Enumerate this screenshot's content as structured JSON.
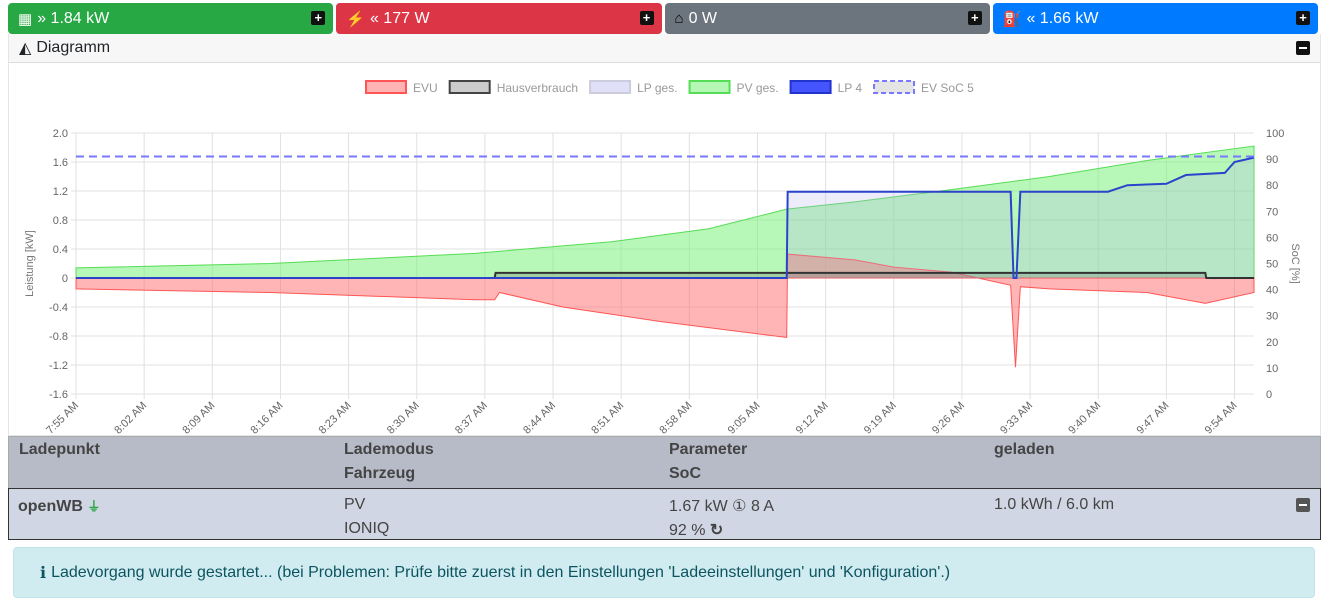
{
  "topbar": [
    {
      "label": "1.84 kW",
      "arrow": "»",
      "icon": "solar-panel-icon",
      "color": "#28a745"
    },
    {
      "label": "177 W",
      "arrow": "«",
      "icon": "power-tower-icon",
      "color": "#dc3545"
    },
    {
      "label": "0 W",
      "arrow": "",
      "icon": "home-icon",
      "color": "#6c757d"
    },
    {
      "label": "1.66 kW",
      "arrow": "«",
      "icon": "charging-station-icon",
      "color": "#007bff"
    }
  ],
  "diagram": {
    "title": "Diagramm"
  },
  "chart_data": {
    "type": "area",
    "legend": [
      "EVU",
      "Hausverbrauch",
      "LP ges.",
      "PV ges.",
      "LP 4",
      "EV SoC 5"
    ],
    "legend_placement": "top",
    "ylabel": "Leistung [kW]",
    "y2label": "SoC [%]",
    "ylim": [
      -1.6,
      2.0
    ],
    "yticks": [
      "2.0",
      "1.6",
      "1.2",
      "0.8",
      "0.4",
      "0",
      "-0.4",
      "-0.8",
      "-1.2",
      "-1.6"
    ],
    "y2lim": [
      0,
      100
    ],
    "y2ticks": [
      "100",
      "90",
      "80",
      "70",
      "60",
      "50",
      "40",
      "30",
      "20",
      "10",
      "0"
    ],
    "xunit": "minutes since 7:55",
    "xlim": [
      0,
      121
    ],
    "xticks": [
      "7:55 AM",
      "8:02 AM",
      "8:09 AM",
      "8:16 AM",
      "8:23 AM",
      "8:30 AM",
      "8:37 AM",
      "8:44 AM",
      "8:51 AM",
      "8:58 AM",
      "9:05 AM",
      "9:12 AM",
      "9:19 AM",
      "9:26 AM",
      "9:33 AM",
      "9:40 AM",
      "9:47 AM",
      "9:54 AM"
    ],
    "series": [
      {
        "name": "PV ges.",
        "color": "#7cf07c",
        "x": [
          0,
          20,
          41,
          55,
          65,
          73,
          80,
          90,
          100,
          110,
          121
        ],
        "y": [
          0.14,
          0.2,
          0.34,
          0.5,
          0.68,
          0.95,
          1.05,
          1.22,
          1.4,
          1.62,
          1.82
        ]
      },
      {
        "name": "EVU",
        "color": "#ff6b6b",
        "x": [
          0,
          20,
          41,
          43,
          43.5,
          50,
          60,
          73,
          73.1,
          80,
          84,
          90,
          96,
          96.5,
          97,
          100,
          110,
          116,
          121
        ],
        "y": [
          -0.15,
          -0.2,
          -0.3,
          -0.3,
          -0.2,
          -0.4,
          -0.6,
          -0.82,
          0.33,
          0.25,
          0.15,
          0.08,
          -0.1,
          -1.23,
          -0.12,
          -0.15,
          -0.2,
          -0.35,
          -0.2
        ]
      },
      {
        "name": "Hausverbrauch",
        "color": "#333333",
        "x": [
          0,
          43,
          43.1,
          116,
          116.1,
          121
        ],
        "y": [
          0,
          0,
          0.07,
          0.07,
          0,
          0
        ]
      },
      {
        "name": "LP 4",
        "color": "#2233dd",
        "x": [
          0,
          73,
          73.1,
          96,
          96.3,
          96.6,
          97,
          106,
          108,
          112,
          114,
          118,
          119,
          121
        ],
        "y": [
          0,
          0,
          1.19,
          1.19,
          0,
          0,
          1.19,
          1.19,
          1.28,
          1.3,
          1.42,
          1.45,
          1.6,
          1.66
        ]
      },
      {
        "name": "EV SoC 5",
        "color": "#7777ff",
        "soc": 91
      }
    ]
  },
  "table": {
    "headers": {
      "col1": "Ladepunkt",
      "col2a": "Lademodus",
      "col2b": "Fahrzeug",
      "col3a": "Parameter",
      "col3b": "SoC",
      "col4": "geladen"
    },
    "row": {
      "name": "openWB",
      "mode": "PV",
      "vehicle": "IONIQ",
      "power": "1.67 kW",
      "phases": "①",
      "current": "8 A",
      "soc": "92 %",
      "charged": "1.0 kWh / 6.0 km"
    }
  },
  "alert": {
    "text": "Ladevorgang wurde gestartet... (bei Problemen: Prüfe bitte zuerst in den Einstellungen 'Ladeeinstellungen' und 'Konfiguration'.)"
  }
}
